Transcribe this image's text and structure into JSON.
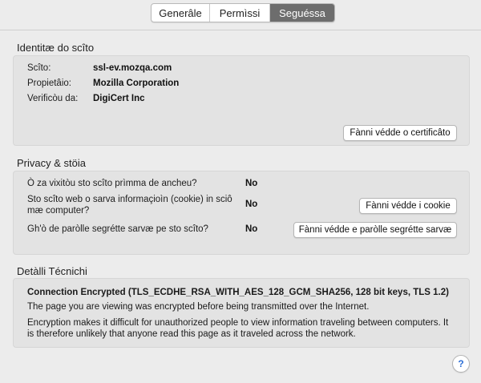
{
  "tabs": [
    {
      "label": "Generâle"
    },
    {
      "label": "Permìssi"
    },
    {
      "label": "Seguéssa"
    }
  ],
  "identity": {
    "title": "Identitæ do scîto",
    "site_label": "Scîto:",
    "site_value": "ssl-ev.mozqa.com",
    "owner_label": "Propietâio:",
    "owner_value": "Mozilla Corporation",
    "verified_label": "Verificòu da:",
    "verified_value": "DigiCert Inc",
    "view_cert_button": "Fànni védde o certificâto"
  },
  "privacy": {
    "title": "Privacy & stöia",
    "visited_question": "Ò za vixitòu sto scîto prìmma de ancheu?",
    "visited_value": "No",
    "cookies_question": "Sto scîto web o sarva informaçioìn (cookie) in sciô mæ computer?",
    "cookies_value": "No",
    "cookies_button": "Fànni védde i cookie",
    "passwords_question": "Gh'ò de paròlle segrétte sarvæ pe sto scîto?",
    "passwords_value": "No",
    "passwords_button": "Fànni védde e paròlle segrétte sarvæ"
  },
  "technical": {
    "title": "Detàlli Técnichi",
    "connection": "Connection Encrypted (TLS_ECDHE_RSA_WITH_AES_128_GCM_SHA256, 128 bit keys, TLS 1.2)",
    "line1": "The page you are viewing was encrypted before being transmitted over the Internet.",
    "line2": "Encryption makes it difficult for unauthorized people to view information traveling between computers. It is therefore unlikely that anyone read this page as it traveled across the network."
  },
  "help_button": "?"
}
